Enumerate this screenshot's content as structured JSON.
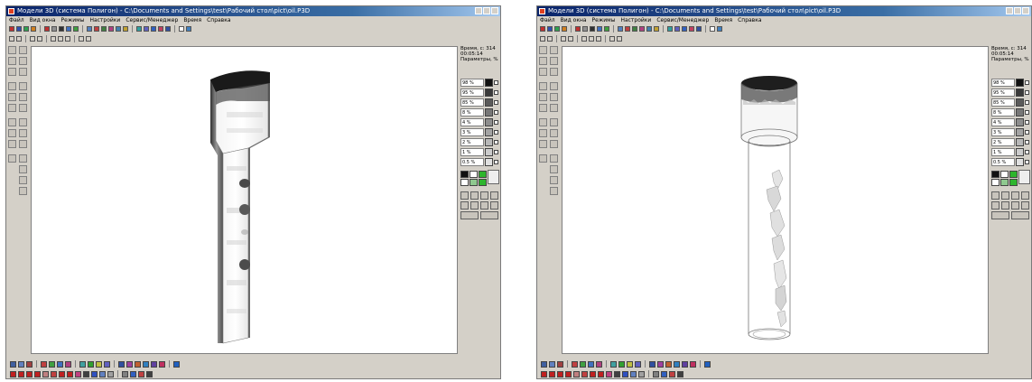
{
  "windows": [
    {
      "title": "Модели 3D (система Полигон) - C:\\Documents and Settings\\test\\Рабочий стол\\pict\\oil.P3D",
      "menu": [
        "Файл",
        "Вид окна",
        "Режимы",
        "Настройки",
        "Сервис/Менеджер",
        "Время",
        "Справка"
      ],
      "info": {
        "time_line": "Время, с: 314",
        "clock": "00:05:14",
        "param": "Параметры, %"
      },
      "legend": [
        {
          "label": "98 %",
          "color": "#111111"
        },
        {
          "label": "95 %",
          "color": "#3a3a3a"
        },
        {
          "label": "85 %",
          "color": "#5a5a5a"
        },
        {
          "label": "8 %",
          "color": "#777777"
        },
        {
          "label": "4 %",
          "color": "#8e8e8e"
        },
        {
          "label": "3 %",
          "color": "#a4a4a4"
        },
        {
          "label": "2 %",
          "color": "#b8b8b8"
        },
        {
          "label": "1 %",
          "color": "#cccccc"
        },
        {
          "label": "0.5 %",
          "color": "#e0e0e0"
        }
      ],
      "palette": [
        "#111111",
        "#ffffff",
        "#2db52d",
        "#ffffff",
        "#8fc98f",
        "#2db52d"
      ]
    },
    {
      "title": "Модели 3D (система Полигон) - C:\\Documents and Settings\\test\\Рабочий стол\\pict\\oil.P3D",
      "menu": [
        "Файл",
        "Вид окна",
        "Режимы",
        "Настройки",
        "Сервис/Менеджер",
        "Время",
        "Справка"
      ],
      "info": {
        "time_line": "Время, с: 314",
        "clock": "00:05:14",
        "param": "Параметры, %"
      },
      "legend": [
        {
          "label": "98 %",
          "color": "#111111"
        },
        {
          "label": "95 %",
          "color": "#3a3a3a"
        },
        {
          "label": "85 %",
          "color": "#5a5a5a"
        },
        {
          "label": "8 %",
          "color": "#777777"
        },
        {
          "label": "4 %",
          "color": "#8e8e8e"
        },
        {
          "label": "3 %",
          "color": "#a4a4a4"
        },
        {
          "label": "2 %",
          "color": "#b8b8b8"
        },
        {
          "label": "1 %",
          "color": "#cccccc"
        },
        {
          "label": "0.5 %",
          "color": "#e0e0e0"
        }
      ],
      "palette": [
        "#111111",
        "#ffffff",
        "#2db52d",
        "#ffffff",
        "#8fc98f",
        "#2db52d"
      ]
    }
  ]
}
